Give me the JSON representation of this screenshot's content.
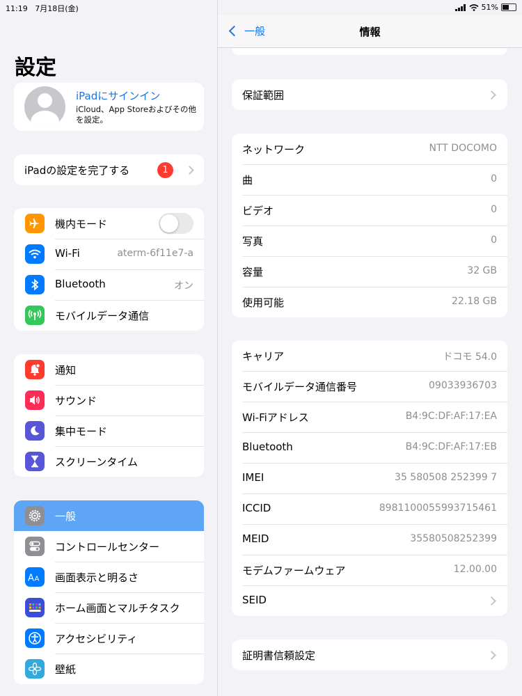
{
  "status": {
    "time": "11:19",
    "date": "7月18日(金)",
    "battery": "51%",
    "battery_level": 0.51
  },
  "sidebar": {
    "title": "設定",
    "profile": {
      "signin": "iPadにサインイン",
      "subtitle": "iCloud、App Storeおよびその他を設定。"
    },
    "finish": {
      "label": "iPadの設定を完了する",
      "badge": "1"
    },
    "group1": [
      {
        "label": "機内モード",
        "icon": "airplane-icon",
        "color": "#ff9500"
      },
      {
        "label": "Wi-Fi",
        "value": "aterm-6f11e7-a",
        "icon": "wifi-icon",
        "color": "#007aff"
      },
      {
        "label": "Bluetooth",
        "value": "オン",
        "icon": "bluetooth-icon",
        "color": "#007aff"
      },
      {
        "label": "モバイルデータ通信",
        "icon": "cellular-icon",
        "color": "#34c759"
      }
    ],
    "group2": [
      {
        "label": "通知",
        "icon": "notification-bell-icon",
        "color": "#ff3b30"
      },
      {
        "label": "サウンド",
        "icon": "speaker-icon",
        "color": "#ff2d55"
      },
      {
        "label": "集中モード",
        "icon": "moon-icon",
        "color": "#5856d6"
      },
      {
        "label": "スクリーンタイム",
        "icon": "hourglass-icon",
        "color": "#5856d6"
      }
    ],
    "group3": [
      {
        "label": "一般",
        "icon": "gear-icon",
        "color": "#8e8e93"
      },
      {
        "label": "コントロールセンター",
        "icon": "switches-icon",
        "color": "#8e8e93"
      },
      {
        "label": "画面表示と明るさ",
        "icon": "text-size-icon",
        "color": "#007aff"
      },
      {
        "label": "ホーム画面とマルチタスク",
        "icon": "home-grid-icon",
        "color": "#3a4ed8"
      },
      {
        "label": "アクセシビリティ",
        "icon": "accessibility-icon",
        "color": "#007aff"
      },
      {
        "label": "壁紙",
        "icon": "flower-icon",
        "color": "#34aadc"
      }
    ]
  },
  "detail": {
    "back": "一般",
    "title": "情報",
    "card1": [
      {
        "label": "保証範囲"
      }
    ],
    "card2": [
      {
        "label": "ネットワーク",
        "value": "NTT DOCOMO"
      },
      {
        "label": "曲",
        "value": "0"
      },
      {
        "label": "ビデオ",
        "value": "0"
      },
      {
        "label": "写真",
        "value": "0"
      },
      {
        "label": "容量",
        "value": "32 GB"
      },
      {
        "label": "使用可能",
        "value": "22.18 GB"
      }
    ],
    "card3": [
      {
        "label": "キャリア",
        "value": "ドコモ 54.0"
      },
      {
        "label": "モバイルデータ通信番号",
        "value": "09033936703"
      },
      {
        "label": "Wi-Fiアドレス",
        "value": "B4:9C:DF:AF:17:EA"
      },
      {
        "label": "Bluetooth",
        "value": "B4:9C:DF:AF:17:EB"
      },
      {
        "label": "IMEI",
        "value": "35 580508 252399 7"
      },
      {
        "label": "ICCID",
        "value": "8981100055993715461"
      },
      {
        "label": "MEID",
        "value": "35580508252399"
      },
      {
        "label": "モデムファームウェア",
        "value": "12.00.00"
      },
      {
        "label": "SEID"
      }
    ],
    "card4": [
      {
        "label": "証明書信頼設定"
      }
    ]
  }
}
